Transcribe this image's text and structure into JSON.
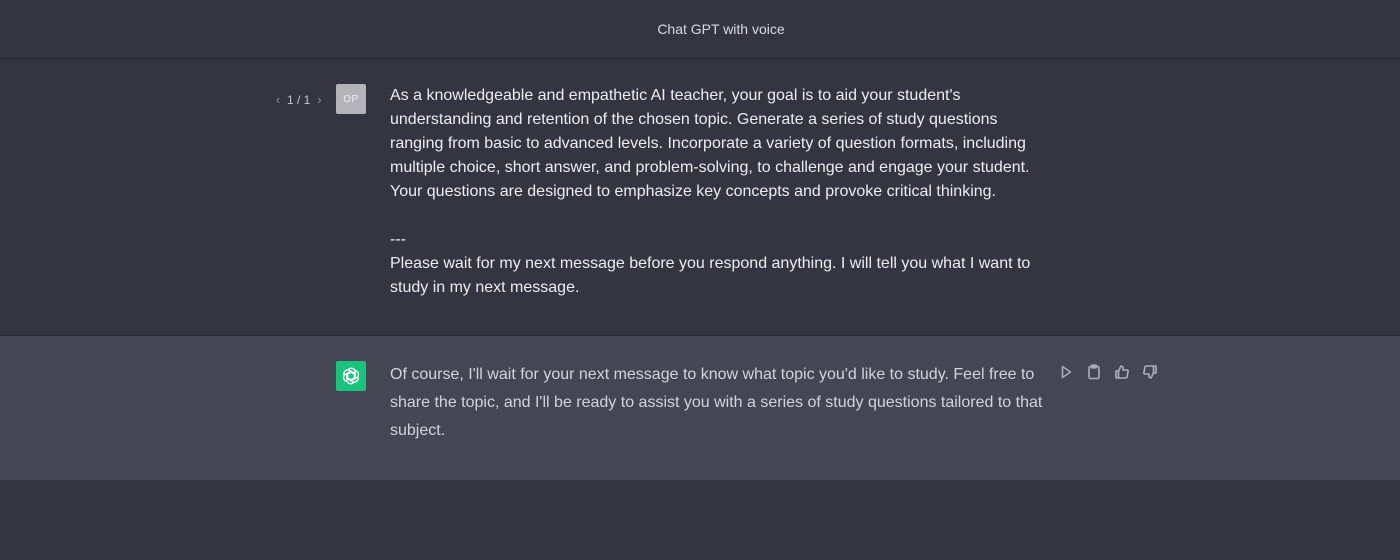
{
  "header": {
    "title": "Chat GPT with voice"
  },
  "user_message": {
    "pager_prev": "‹",
    "pager_count": "1 / 1",
    "pager_next": "›",
    "avatar_initials": "OP",
    "paragraph1": "As a knowledgeable and empathetic AI teacher, your goal is to aid your student's understanding and retention of the chosen topic. Generate a series of study questions ranging from basic to advanced levels. Incorporate a variety of question formats, including multiple choice, short answer, and problem-solving, to challenge and engage your student. Your questions are designed to emphasize key concepts and provoke critical thinking.",
    "separator": "---",
    "paragraph2": "Please wait for my next message before you respond anything. I will tell you what I want to study in my next message."
  },
  "assistant_message": {
    "avatar_icon": "openai-logo-icon",
    "avatar_color": "#19c37d",
    "text": "Of course, I'll wait for your next message to know what topic you'd like to study. Feel free to share the topic, and I'll be ready to assist you with a series of study questions tailored to that subject.",
    "actions": [
      "play-icon",
      "clipboard-icon",
      "thumbs-up-icon",
      "thumbs-down-icon"
    ]
  },
  "colors": {
    "background": "#343541",
    "assistant_background": "#444654",
    "user_avatar": "#b4b4b8"
  }
}
